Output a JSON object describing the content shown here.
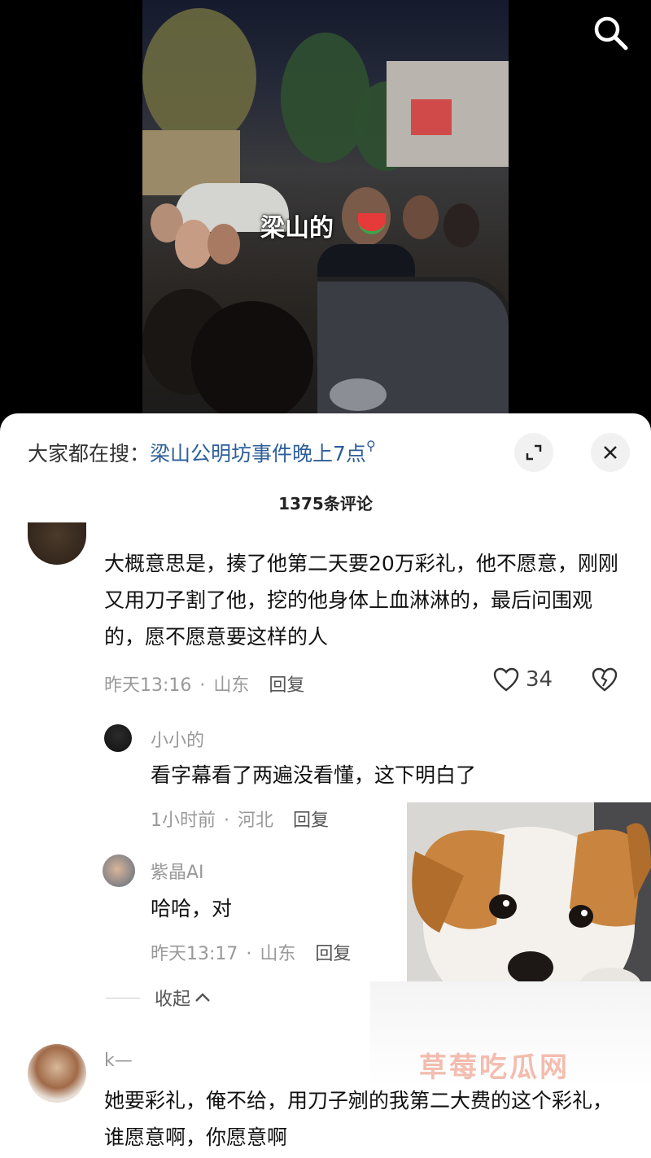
{
  "video": {
    "caption": "梁山的"
  },
  "icons": {
    "search": "search-icon",
    "expand": "expand-icon",
    "close": "close-icon",
    "like": "heart-icon",
    "dislike": "broken-heart-icon",
    "collapse": "chevron-up-icon"
  },
  "search_bar": {
    "prefix": "大家都在搜：",
    "query": "梁山公明坊事件晚上7点"
  },
  "comment_count": "1375条评论",
  "comments": [
    {
      "text": "大概意思是，揍了他第二天要20万彩礼，他不愿意，刚刚又用刀子割了他，挖的他身体上血淋淋的，最后问围观的，愿不愿意要这样的人",
      "time": "昨天13:16",
      "location": "山东",
      "reply_label": "回复",
      "likes": "34",
      "replies": [
        {
          "username": "小小的",
          "text": "看字幕看了两遍没看懂，这下明白了",
          "time": "1小时前",
          "location": "河北",
          "reply_label": "回复"
        },
        {
          "username": "紫晶AI",
          "text": "哈哈，对",
          "time": "昨天13:17",
          "location": "山东",
          "reply_label": "回复"
        }
      ],
      "collapse_label": "收起"
    },
    {
      "username": "k—",
      "text": "她要彩礼，俺不给，用刀子剜的我第二大费的这个彩礼，谁愿意啊，你愿意啊"
    }
  ],
  "watermark": "草莓吃瓜网",
  "colors": {
    "link": "#2d5f9a",
    "muted": "#999999",
    "background": "#ffffff"
  }
}
